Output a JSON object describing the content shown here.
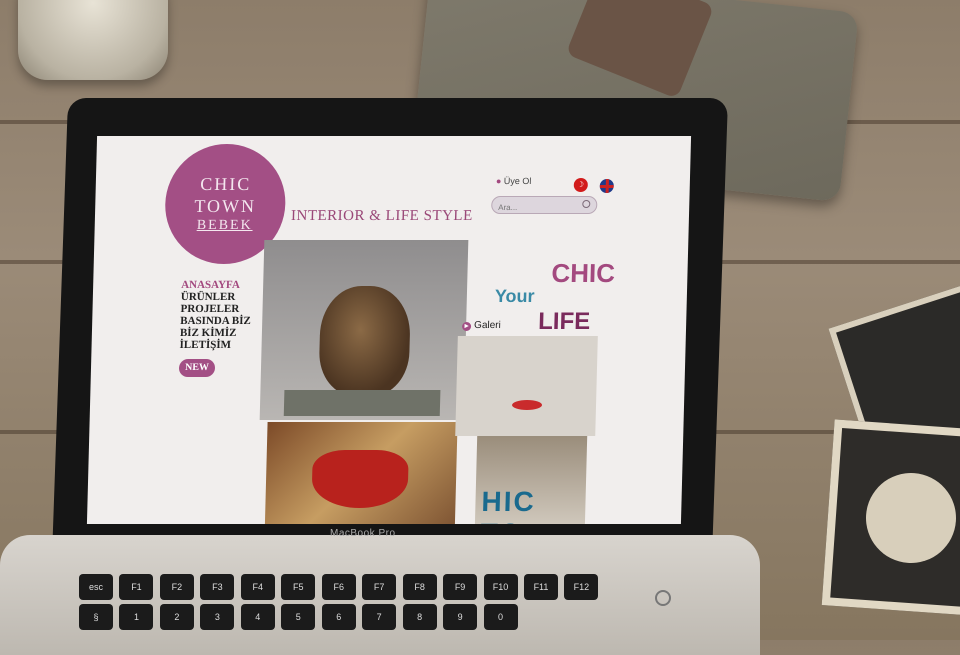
{
  "scene": {
    "laptop_label": "MacBook Pro",
    "keyboard_keys": [
      "esc",
      "F1",
      "F2",
      "F3",
      "F4",
      "F5",
      "F6",
      "F7",
      "F8",
      "F9",
      "F10",
      "F11",
      "F12",
      "§",
      "1",
      "2",
      "3",
      "4",
      "5",
      "6",
      "7",
      "8",
      "9",
      "0"
    ]
  },
  "site": {
    "logo": {
      "line1": "CHIC",
      "line2": "TOWN",
      "line3": "BEBEK"
    },
    "tagline": "INTERIOR & LIFE STYLE",
    "member_link": "Üye Ol",
    "search": {
      "placeholder": "Ara..."
    },
    "nav": {
      "items": [
        "ANASAYFA",
        "ÜRÜNLER",
        "PROJELER",
        "BASINDA BİZ",
        "BİZ KİMİZ",
        "İLETİŞİM"
      ],
      "badge": "NEW"
    },
    "slogan": {
      "chic": "CHIC",
      "your": "Your",
      "life": "LIFE"
    },
    "gallery_link": "Galeri",
    "store_sign": "HIC TO"
  },
  "colors": {
    "brand": "#a34f85",
    "accent_blue": "#3a8aa6"
  }
}
